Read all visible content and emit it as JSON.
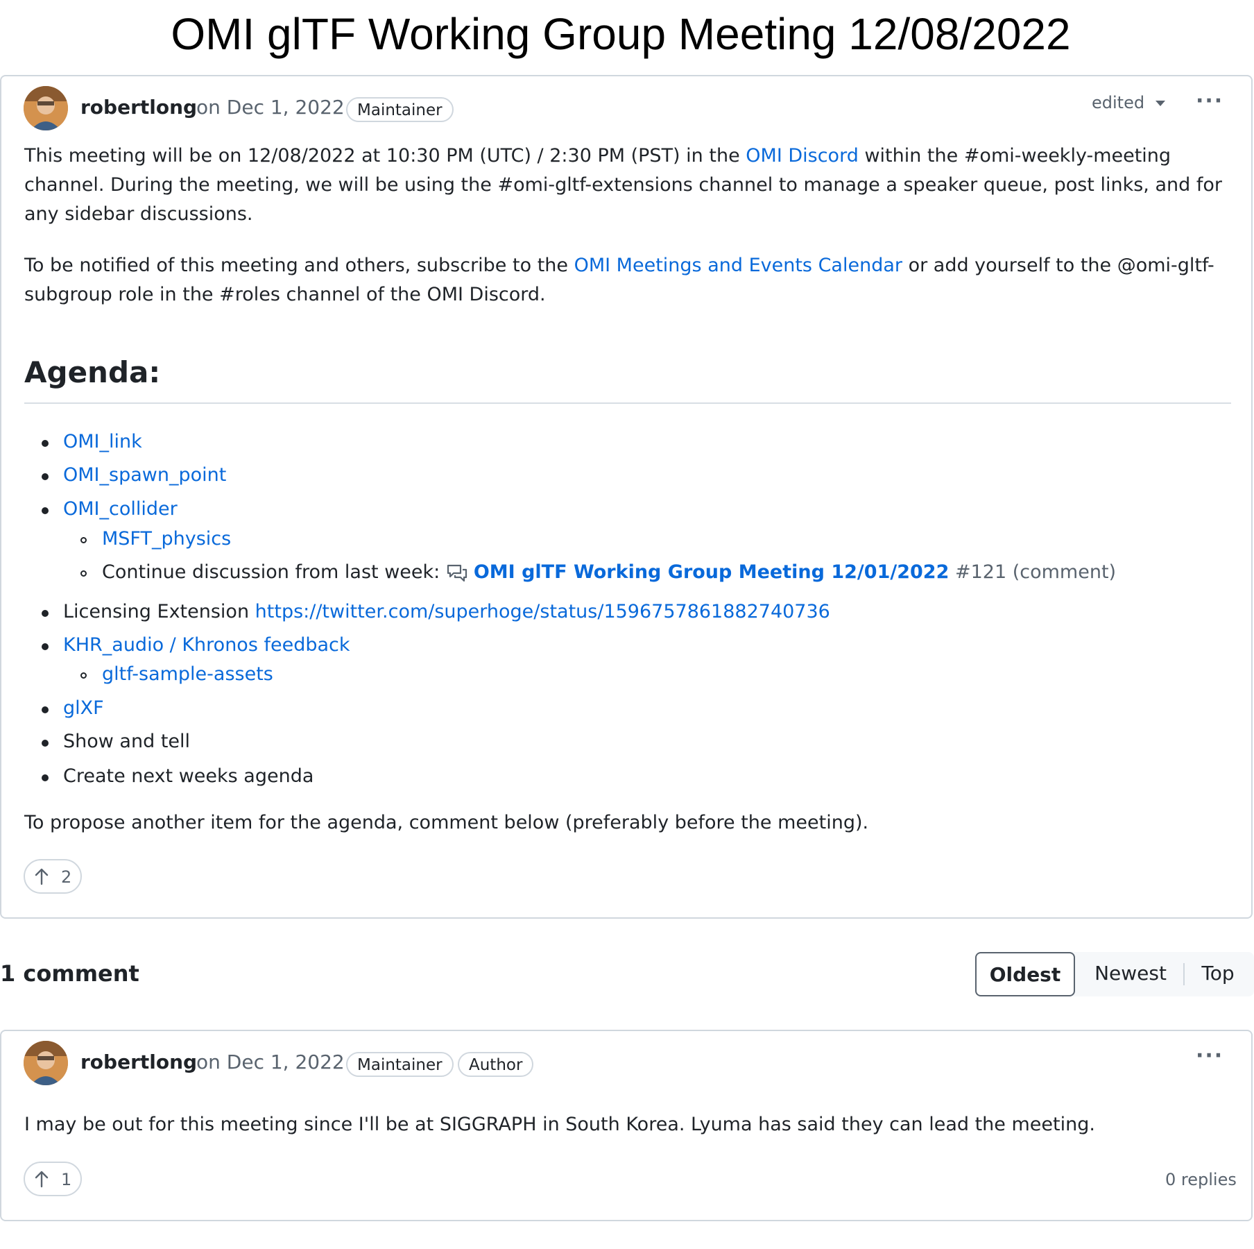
{
  "page": {
    "title": "OMI glTF Working Group Meeting 12/08/2022"
  },
  "post": {
    "author": "robertlong",
    "date": "on Dec 1, 2022",
    "badges": [
      "Maintainer"
    ],
    "edited_label": "edited",
    "more_label": "···",
    "para1_a": "This meeting will be on 12/08/2022 at 10:30 PM (UTC) / 2:30 PM (PST) in the ",
    "para1_link": "OMI Discord",
    "para1_b": " within the #omi-weekly-meeting channel. During the meeting, we will be using the #omi-gltf-extensions channel to manage a speaker queue, post links, and for any sidebar discussions.",
    "para2_a": "To be notified of this meeting and others, subscribe to the ",
    "para2_link": "OMI Meetings and Events Calendar",
    "para2_b": " or add yourself to the @omi-gltf-subgroup role in the #roles channel of the OMI Discord.",
    "agenda_heading": "Agenda:",
    "agenda": {
      "omi_link": "OMI_link",
      "omi_spawn_point": "OMI_spawn_point",
      "omi_collider": "OMI_collider",
      "msft_physics": "MSFT_physics",
      "continue_text": "Continue discussion from last week: ",
      "continue_link": "OMI glTF Working Group Meeting 12/01/2022",
      "continue_number": "#121",
      "continue_comment": "(comment)",
      "licensing_text": "Licensing Extension ",
      "licensing_link": "https://twitter.com/superhoge/status/1596757861882740736",
      "khr_audio": "KHR_audio / Khronos feedback",
      "gltf_sample_assets": "gltf-sample-assets",
      "glxf": "glXF",
      "show_and_tell": "Show and tell",
      "next_agenda": "Create next weeks agenda"
    },
    "closing": "To propose another item for the agenda, comment below (preferably before the meeting).",
    "upvotes": "2",
    "upvote_icon": "arrow-up-icon"
  },
  "comments": {
    "heading": "1 comment",
    "sort": {
      "oldest": "Oldest",
      "newest": "Newest",
      "top": "Top",
      "selected": "Oldest"
    },
    "items": [
      {
        "author": "robertlong",
        "date": "on Dec 1, 2022",
        "badges": [
          "Maintainer",
          "Author"
        ],
        "more_label": "···",
        "text": "I may be out for this meeting since I'll be at SIGGRAPH in South Korea. Lyuma has said they can lead the meeting.",
        "upvotes": "1",
        "replies": "0 replies"
      }
    ]
  },
  "colors": {
    "link": "#0969da",
    "text": "#1f2328",
    "muted": "#59636e",
    "border": "#d0d7de"
  }
}
